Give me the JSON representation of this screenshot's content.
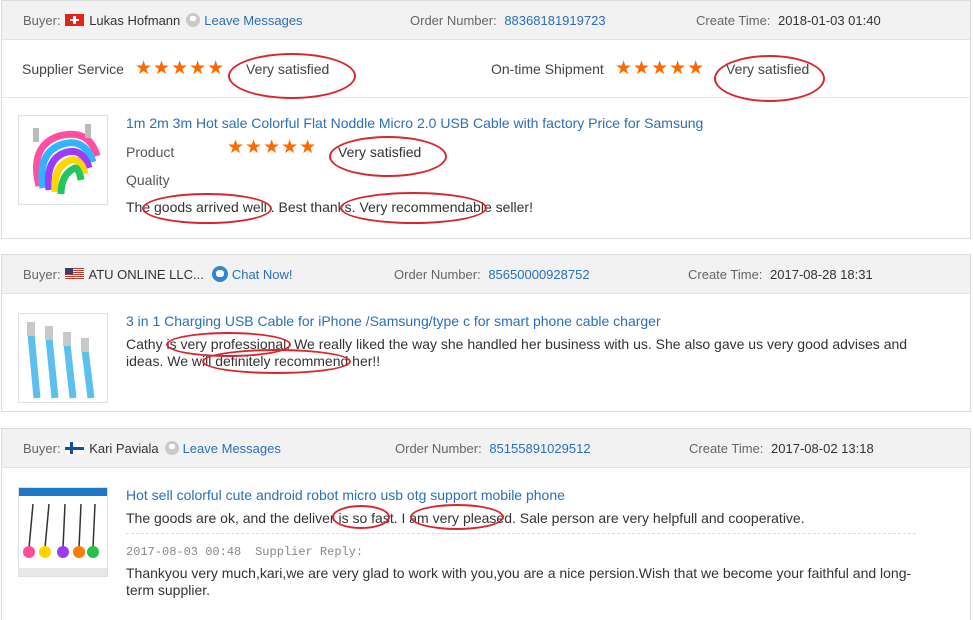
{
  "labels": {
    "buyer": "Buyer:",
    "order_number": "Order Number:",
    "create_time": "Create Time:",
    "supplier_service": "Supplier Service",
    "on_time_shipment": "On-time Shipment",
    "product": "Product",
    "quality": "Quality",
    "supplier_reply": "Supplier Reply:"
  },
  "stars": "★★★★★",
  "feedback": [
    {
      "buyer_name": "Lukas Hofmann",
      "contact_label": "Leave Messages",
      "order_number": "88368181919723",
      "create_time": "2018-01-03 01:40",
      "supplier_service_rating": "Very satisfied",
      "on_time_shipment_rating": "Very satisfied",
      "product_title": "1m 2m 3m Hot sale Colorful Flat Noddle Micro 2.0 USB Cable with factory Price for Samsung",
      "product_quality_rating": "Very satisfied",
      "comment": "The goods arrived well . Best thanks. Very recommendable seller!"
    },
    {
      "buyer_name": "ATU ONLINE LLC...",
      "contact_label": "Chat Now!",
      "order_number": "85650000928752",
      "create_time": "2017-08-28 18:31",
      "product_title": "3 in 1 Charging USB Cable for iPhone /Samsung/type c for smart phone cable charger",
      "comment_line1": "Cathy is very professional. We really liked the way she handled her business with us. She also gave us very good advises and",
      "comment_line2": "ideas. We will definitely recommend her!!"
    },
    {
      "buyer_name": "Kari Paviala",
      "contact_label": "Leave Messages",
      "order_number": "85155891029512",
      "create_time": "2017-08-02 13:18",
      "product_title": "Hot sell colorful cute android robot micro usb otg support mobile phone",
      "comment": "The goods are ok, and the deliver is so fast. I am very pleased. Sale person are very helpfull and cooperative.",
      "reply_time": "2017-08-03 00:48",
      "reply_line1": "Thankyou very much,kari,we are very glad to work with you,you are a nice persion.Wish that we become your faithful and long-",
      "reply_line2": "term supplier."
    }
  ],
  "colors": {
    "link": "#2a6fb8",
    "star": "#ff6a00",
    "satisfied_green": "#2c9a22",
    "annotation_red": "#d8262e",
    "header_bg": "#f2f2f2"
  }
}
